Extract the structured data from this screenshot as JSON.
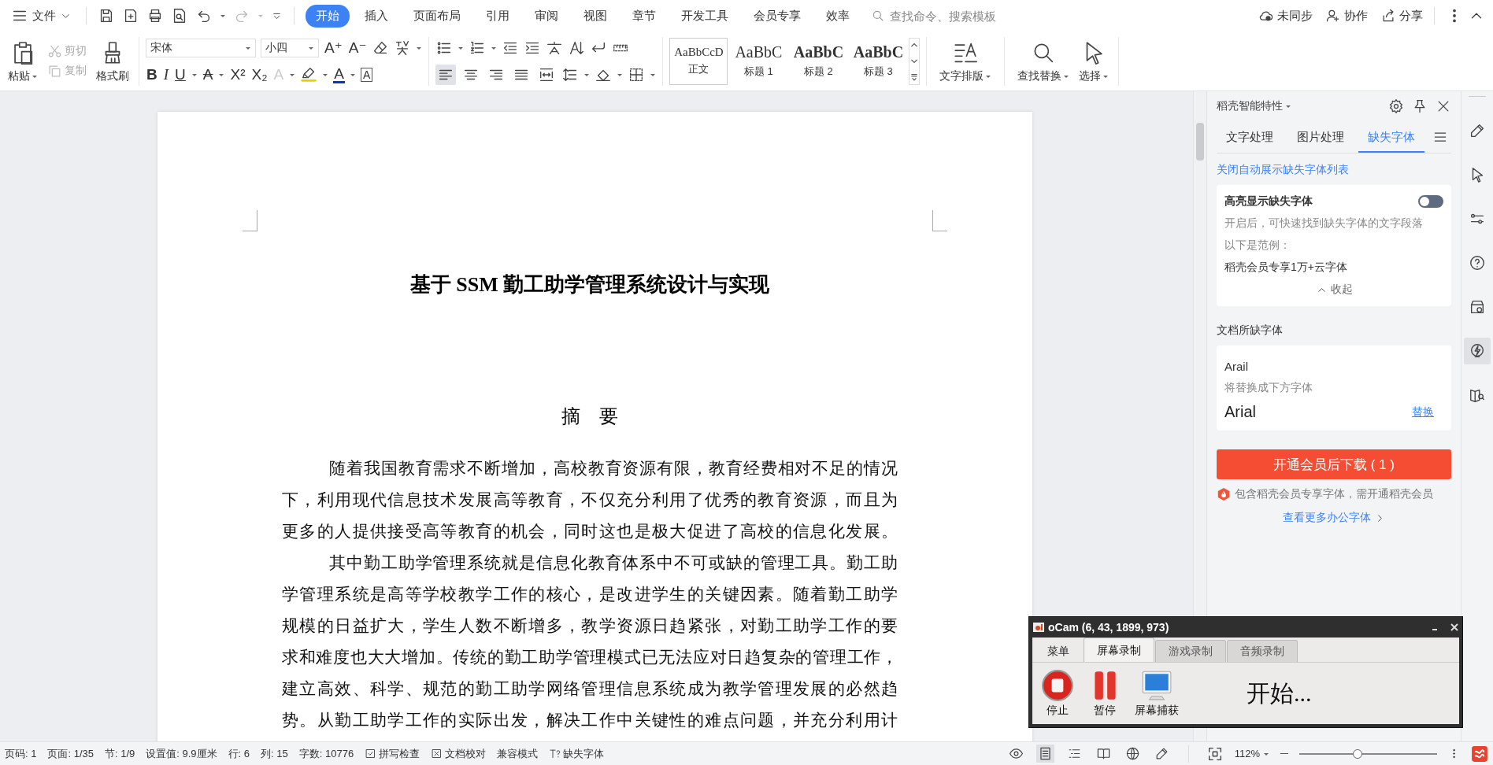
{
  "menu_bar": {
    "file_menu": "文件",
    "tabs": [
      {
        "label": "开始",
        "selected": true
      },
      {
        "label": "插入",
        "selected": false
      },
      {
        "label": "页面布局",
        "selected": false
      },
      {
        "label": "引用",
        "selected": false
      },
      {
        "label": "审阅",
        "selected": false
      },
      {
        "label": "视图",
        "selected": false
      },
      {
        "label": "章节",
        "selected": false
      },
      {
        "label": "开发工具",
        "selected": false
      },
      {
        "label": "会员专享",
        "selected": false
      },
      {
        "label": "效率",
        "selected": false
      }
    ],
    "search": {
      "placeholder": "查找命令、搜索模板"
    },
    "actions": [
      {
        "kind": "sync",
        "label": "未同步"
      },
      {
        "kind": "collab",
        "label": "协作"
      },
      {
        "kind": "share",
        "label": "分享"
      }
    ]
  },
  "ribbon": {
    "clipboard": [
      {
        "kind": "paste",
        "label": "粘贴",
        "disabled": false
      },
      {
        "kind": "cut",
        "label": "剪切",
        "disabled": true
      },
      {
        "kind": "copy",
        "label": "复制",
        "disabled": true
      },
      {
        "kind": "painter",
        "label": "格式刷",
        "disabled": false
      }
    ],
    "font": {
      "family": "宋体",
      "size": "小四"
    },
    "size_buttons": [
      {
        "glyph": "A⁺"
      },
      {
        "glyph": "A⁻"
      }
    ],
    "font_buttons": [
      {
        "kind": "bold",
        "glyph": "B"
      },
      {
        "kind": "italic",
        "glyph": "I"
      },
      {
        "kind": "underline",
        "glyph": "U"
      },
      {
        "kind": "strike",
        "glyph": "A"
      },
      {
        "kind": "superscript",
        "glyph": "X²"
      },
      {
        "kind": "subscript",
        "glyph": "X₂"
      },
      {
        "kind": "effect",
        "glyph": "A"
      },
      {
        "kind": "highlight"
      },
      {
        "kind": "color",
        "glyph": "A"
      },
      {
        "kind": "boxed",
        "glyph": "A"
      }
    ],
    "alignment": [
      {
        "kind": "left",
        "selected": true
      },
      {
        "kind": "center",
        "selected": false
      },
      {
        "kind": "right",
        "selected": false
      },
      {
        "kind": "justify",
        "selected": false
      },
      {
        "kind": "distributed",
        "selected": false
      }
    ],
    "styles": [
      {
        "kind": "body",
        "preview": "AaBbCcD",
        "label": "正文",
        "selected": true
      },
      {
        "kind": "h1",
        "preview": "AaBbC",
        "label": "标题 1",
        "selected": false
      },
      {
        "kind": "h2",
        "preview": "AaBbC",
        "label": "标题 2",
        "selected": false
      },
      {
        "kind": "h3",
        "preview": "AaBbC",
        "label": "标题 3",
        "selected": false
      }
    ],
    "text_layout": "文字排版",
    "find_replace": "查找替换",
    "select": "选择"
  },
  "document": {
    "title": "基于 SSM 勤工助学管理系统设计与实现",
    "heading": "摘　要",
    "paragraphs": [
      {
        "lines": [
          "随着我国教育需求不断增加，高校教育资源有限，教育经费相对不足的情况",
          "下，利用现代信息技术发展高等教育，不仅充分利用了优秀的教育资源，而且为",
          "更多的人提供接受高等教育的机会，同时这也是极大促进了高校的信息化发展。"
        ]
      },
      {
        "lines": [
          "其中勤工助学管理系统就是信息化教育体系中不可或缺的管理工具。勤工助",
          "学管理系统是高等学校教学工作的核心，是改进学生的关键因素。随着勤工助学",
          "规模的日益扩大，学生人数不断增多，教学资源日趋紧张，对勤工助学工作的要",
          "求和难度也大大增加。传统的勤工助学管理模式已无法应对日趋复杂的管理工作，",
          "建立高效、科学、规范的勤工助学网络管理信息系统成为教学管理发展的必然趋",
          "势。从勤工助学工作的实际出发，解决工作中关键性的难点问题，并充分利用计"
        ]
      }
    ]
  },
  "side_panel": {
    "title": "稻壳智能特性",
    "tabs": [
      {
        "label": "文字处理",
        "selected": false
      },
      {
        "label": "图片处理",
        "selected": false
      },
      {
        "label": "缺失字体",
        "selected": true
      }
    ],
    "auto_list_link": "关闭自动展示缺失字体列表",
    "highlight_card": {
      "title": "高亮显示缺失字体",
      "on": false,
      "description": "开启后，可快速找到缺失字体的文字段落",
      "example_label": "以下是范例：",
      "example": "稻壳会员专享1万+云字体",
      "collapse": "收起"
    },
    "missing_title": "文档所缺字体",
    "missing_fonts": [
      {
        "name": "Arail",
        "hint": "将替换成下方字体",
        "replacement": "Arial",
        "action": "替换"
      }
    ],
    "download_button": "开通会员后下载 ( 1 )",
    "member_note": "包含稻壳会员专享字体，需开通稻壳会员",
    "more_link": "查看更多办公字体"
  },
  "right_toolbar": [
    {
      "kind": "pen",
      "selected": false
    },
    {
      "kind": "cursor",
      "selected": false
    },
    {
      "kind": "sliders",
      "selected": false
    },
    {
      "kind": "help",
      "selected": false
    },
    {
      "kind": "store",
      "selected": false
    },
    {
      "kind": "bolt",
      "selected": true
    },
    {
      "kind": "book",
      "selected": false
    }
  ],
  "ocam": {
    "title": "oCam (6, 43, 1899, 973)",
    "tabs": [
      {
        "kind": "menu",
        "label": "菜单",
        "selected": false
      },
      {
        "kind": "tab",
        "label": "屏幕录制",
        "selected": true
      },
      {
        "kind": "tab",
        "label": "游戏录制",
        "selected": false
      },
      {
        "kind": "tab",
        "label": "音频录制",
        "selected": false
      }
    ],
    "buttons": [
      {
        "kind": "stop",
        "label": "停止"
      },
      {
        "kind": "pause",
        "label": "暂停"
      },
      {
        "kind": "capture",
        "label": "屏幕捕获"
      }
    ],
    "status": "开始..."
  },
  "status_bar": {
    "items": [
      "页码: 1",
      "页面: 1/35",
      "节: 1/9",
      "设置值: 9.9厘米",
      "行: 6",
      "列: 15",
      "字数: 10776"
    ],
    "tools": [
      {
        "kind": "spell",
        "label": "拼写检查"
      },
      {
        "kind": "proof",
        "label": "文档校对"
      },
      {
        "kind": "compat",
        "label": "兼容模式"
      },
      {
        "kind": "font",
        "label": "缺失字体"
      }
    ],
    "views": [
      {
        "kind": "read",
        "selected": false
      },
      {
        "kind": "page",
        "selected": true
      },
      {
        "kind": "outline",
        "selected": false
      },
      {
        "kind": "book",
        "selected": false
      },
      {
        "kind": "web",
        "selected": false
      },
      {
        "kind": "pen",
        "selected": false
      }
    ],
    "zoom": "112%",
    "zoom_slider": {
      "level": 0.42
    }
  }
}
